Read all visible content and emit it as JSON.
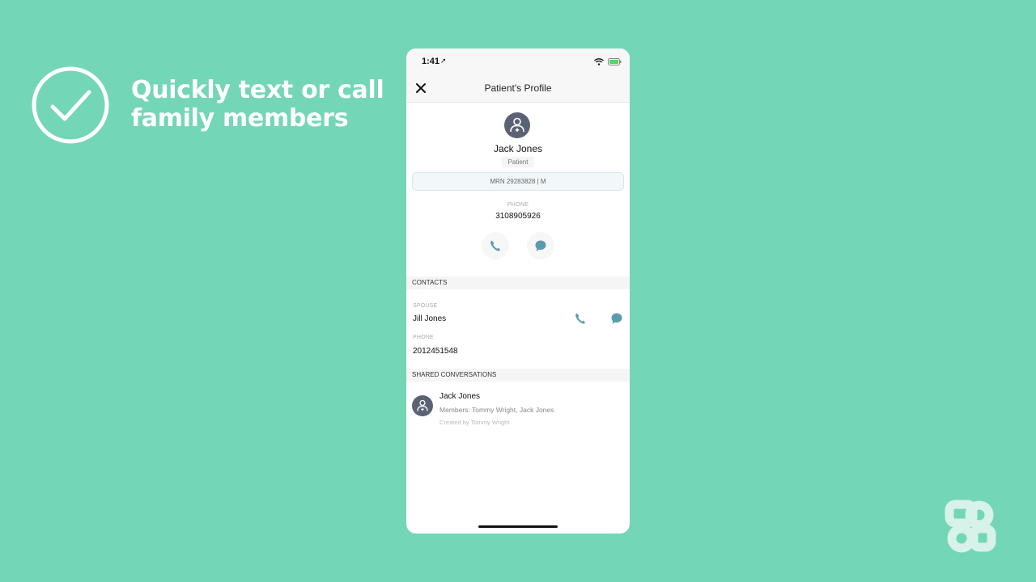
{
  "promo": {
    "headline_line1": "Quickly text or call",
    "headline_line2": "family members"
  },
  "status_bar": {
    "time": "1:41",
    "location_glyph": "➚"
  },
  "nav": {
    "title": "Patient's Profile"
  },
  "patient": {
    "name": "Jack Jones",
    "role": "Patient",
    "mrn": "MRN 29283828 | M",
    "phone_label": "PHONE",
    "phone": "3108905926"
  },
  "contacts": {
    "header": "CONTACTS",
    "relation_label": "SPOUSE",
    "name": "Jill Jones",
    "phone_label": "PHONE",
    "phone": "2012451548"
  },
  "shared": {
    "header": "SHARED CONVERSATIONS",
    "title": "Jack Jones",
    "members": "Members: Tommy Wright, Jack Jones",
    "created": "Created by Tommy Wright"
  },
  "colors": {
    "background": "#73d6b7",
    "accent": "#5b9bb0",
    "avatar": "#5a6274",
    "battery": "#4cd964"
  }
}
